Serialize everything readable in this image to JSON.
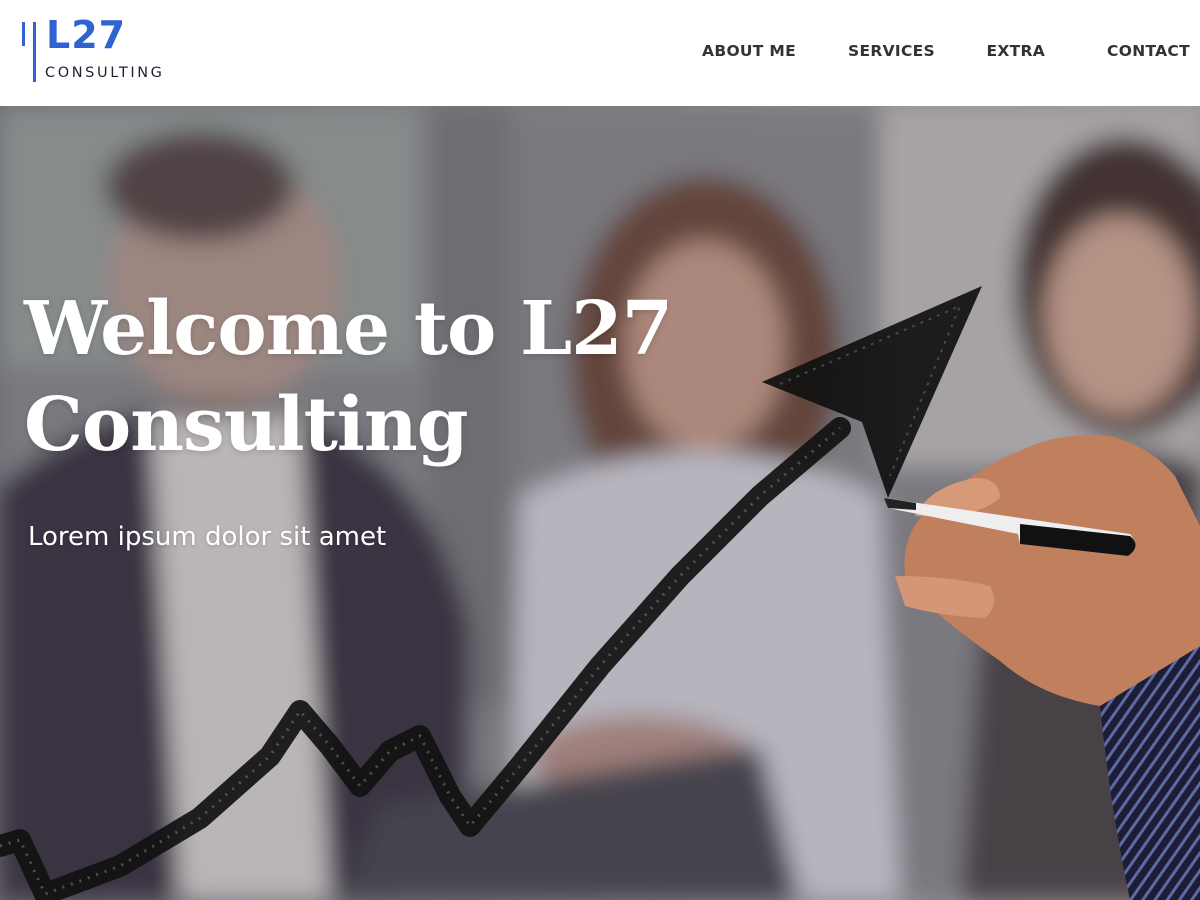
{
  "brand": {
    "mark": "L27",
    "tagline": "CONSULTING",
    "color": "#2f63d1"
  },
  "nav": {
    "items": [
      {
        "label": "ABOUT ME"
      },
      {
        "label": "SERVICES"
      },
      {
        "label": "EXTRA"
      },
      {
        "label": "CONTACT"
      }
    ]
  },
  "hero": {
    "title": "Welcome to L27 Consulting",
    "subtitle": "Lorem ipsum dolor sit amet",
    "background_image": "blurred-business-meeting-photo",
    "overlay_graphic": "hand-drawn-rising-arrow-with-marker"
  }
}
